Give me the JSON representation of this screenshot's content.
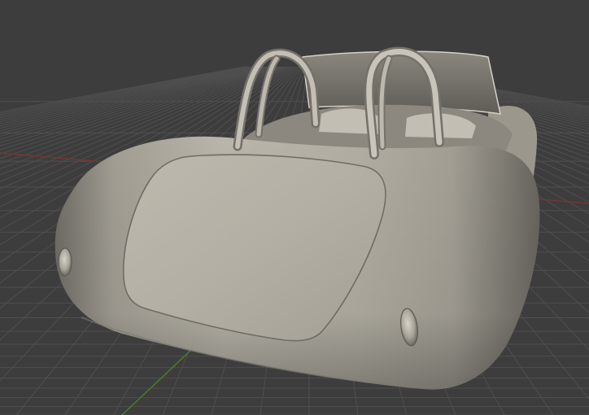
{
  "viewport": {
    "background_color": "#3d3d3d",
    "grid_line_color": "#4f4f4f",
    "x_axis_color": "#7a3434",
    "y_axis_color": "#4c7a26",
    "model_base_color": "#b3afa4"
  },
  "scene": {
    "object": "roadster-car-body",
    "view": "rear-three-quarter"
  }
}
